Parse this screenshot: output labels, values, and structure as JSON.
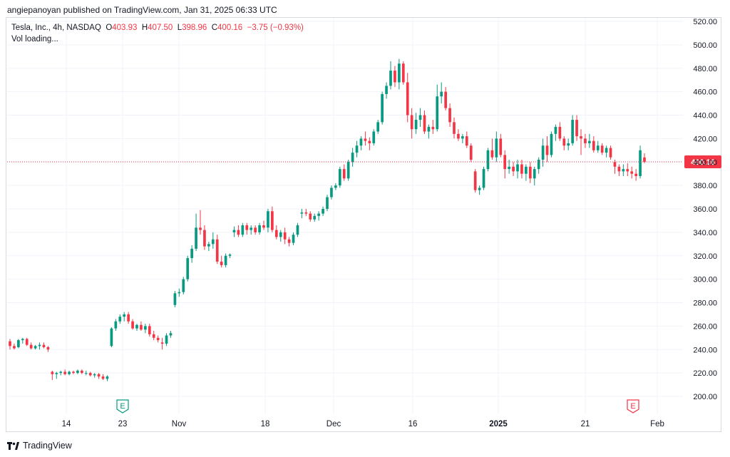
{
  "publisher_line": "angiepanoyan published on TradingView.com, Jan 31, 2025 06:33 UTC",
  "legend": {
    "symbol": "Tesla, Inc., 4h, NASDAQ",
    "o_label": "O",
    "o_value": "403.93",
    "h_label": "H",
    "h_value": "407.50",
    "l_label": "L",
    "l_value": "398.96",
    "c_label": "C",
    "c_value": "400.16",
    "change": "−3.75 (−0.93%)",
    "vol_text": "Vol loading..."
  },
  "footer": {
    "brand": "TradingView"
  },
  "colors": {
    "up": "#089981",
    "down": "#f23645",
    "grid": "#f0f3fa",
    "axis_text": "#131722"
  },
  "chart_data": {
    "type": "candlestick",
    "title": "Tesla, Inc., 4h, NASDAQ",
    "ylim": [
      190,
      525
    ],
    "y_ticks": [
      "520.00",
      "500.00",
      "480.00",
      "460.00",
      "440.00",
      "420.00",
      "400.00",
      "380.00",
      "360.00",
      "340.00",
      "320.00",
      "300.00",
      "280.00",
      "260.00",
      "240.00",
      "220.00",
      "200.00"
    ],
    "x_ticks": [
      "14",
      "23",
      "Nov",
      "18",
      "Dec",
      "16",
      "2025",
      "21",
      "Feb"
    ],
    "last_price_label": "400.16",
    "earnings_markers": [
      {
        "label": "E",
        "after_tick": "23",
        "color": "#089981"
      },
      {
        "label": "E",
        "before_tick": "Feb",
        "color": "#f23645"
      }
    ],
    "candles": [
      [
        247,
        249,
        240,
        243
      ],
      [
        243,
        245,
        240,
        241
      ],
      [
        242,
        249,
        241,
        248
      ],
      [
        248,
        250,
        245,
        249
      ],
      [
        249,
        250,
        243,
        244
      ],
      [
        244,
        246,
        240,
        241
      ],
      [
        241,
        244,
        240,
        243
      ],
      [
        243,
        246,
        240,
        244
      ],
      [
        244,
        246,
        241,
        242
      ],
      [
        242,
        243,
        238,
        240
      ],
      [
        221,
        222,
        214,
        219
      ],
      [
        219,
        221,
        215,
        220
      ],
      [
        220,
        222,
        218,
        221
      ],
      [
        221,
        223,
        218,
        219
      ],
      [
        219,
        222,
        218,
        221
      ],
      [
        221,
        222,
        219,
        220
      ],
      [
        220,
        223,
        219,
        222
      ],
      [
        222,
        223,
        219,
        220
      ],
      [
        220,
        222,
        218,
        220
      ],
      [
        220,
        221,
        217,
        218
      ],
      [
        218,
        220,
        216,
        219
      ],
      [
        219,
        220,
        215,
        217
      ],
      [
        217,
        219,
        214,
        215
      ],
      [
        215,
        218,
        213,
        217
      ],
      [
        243,
        259,
        242,
        258
      ],
      [
        258,
        266,
        256,
        264
      ],
      [
        264,
        270,
        262,
        268
      ],
      [
        268,
        272,
        264,
        270
      ],
      [
        270,
        272,
        262,
        264
      ],
      [
        264,
        266,
        257,
        258
      ],
      [
        258,
        262,
        256,
        261
      ],
      [
        261,
        264,
        256,
        257
      ],
      [
        257,
        262,
        254,
        260
      ],
      [
        260,
        262,
        251,
        253
      ],
      [
        253,
        256,
        248,
        250
      ],
      [
        250,
        252,
        246,
        248
      ],
      [
        246,
        250,
        240,
        245
      ],
      [
        245,
        254,
        243,
        252
      ],
      [
        252,
        256,
        250,
        254
      ],
      [
        278,
        290,
        276,
        288
      ],
      [
        288,
        292,
        285,
        289
      ],
      [
        289,
        302,
        287,
        300
      ],
      [
        300,
        320,
        298,
        318
      ],
      [
        318,
        329,
        314,
        326
      ],
      [
        326,
        356,
        324,
        344
      ],
      [
        344,
        359,
        338,
        342
      ],
      [
        342,
        346,
        325,
        328
      ],
      [
        328,
        332,
        324,
        330
      ],
      [
        330,
        340,
        326,
        334
      ],
      [
        334,
        338,
        313,
        315
      ],
      [
        315,
        320,
        310,
        312
      ],
      [
        312,
        322,
        310,
        320
      ],
      [
        320,
        322,
        318,
        321
      ],
      [
        340,
        345,
        336,
        342
      ],
      [
        342,
        346,
        336,
        338
      ],
      [
        338,
        348,
        336,
        346
      ],
      [
        346,
        348,
        338,
        342
      ],
      [
        342,
        346,
        338,
        344
      ],
      [
        344,
        346,
        338,
        340
      ],
      [
        340,
        348,
        338,
        346
      ],
      [
        346,
        350,
        342,
        344
      ],
      [
        344,
        360,
        340,
        358
      ],
      [
        358,
        362,
        340,
        342
      ],
      [
        342,
        346,
        334,
        336
      ],
      [
        336,
        342,
        332,
        340
      ],
      [
        340,
        344,
        330,
        334
      ],
      [
        334,
        336,
        328,
        331
      ],
      [
        331,
        340,
        329,
        338
      ],
      [
        338,
        348,
        336,
        346
      ],
      [
        356,
        360,
        352,
        357
      ],
      [
        357,
        360,
        354,
        356
      ],
      [
        356,
        358,
        349,
        351
      ],
      [
        351,
        356,
        349,
        354
      ],
      [
        354,
        358,
        350,
        356
      ],
      [
        356,
        362,
        354,
        360
      ],
      [
        360,
        372,
        358,
        370
      ],
      [
        370,
        380,
        368,
        378
      ],
      [
        378,
        382,
        376,
        380
      ],
      [
        380,
        396,
        378,
        394
      ],
      [
        394,
        398,
        384,
        386
      ],
      [
        386,
        402,
        384,
        400
      ],
      [
        400,
        412,
        396,
        408
      ],
      [
        408,
        418,
        404,
        414
      ],
      [
        414,
        422,
        410,
        420
      ],
      [
        420,
        426,
        414,
        418
      ],
      [
        418,
        421,
        410,
        416
      ],
      [
        416,
        428,
        414,
        426
      ],
      [
        426,
        436,
        424,
        434
      ],
      [
        434,
        460,
        432,
        458
      ],
      [
        458,
        468,
        454,
        465
      ],
      [
        465,
        486,
        462,
        478
      ],
      [
        478,
        482,
        464,
        468
      ],
      [
        468,
        488,
        462,
        484
      ],
      [
        484,
        486,
        466,
        468
      ],
      [
        468,
        476,
        434,
        440
      ],
      [
        440,
        446,
        420,
        428
      ],
      [
        428,
        442,
        424,
        436
      ],
      [
        436,
        446,
        430,
        440
      ],
      [
        440,
        444,
        424,
        426
      ],
      [
        426,
        432,
        420,
        430
      ],
      [
        430,
        436,
        424,
        428
      ],
      [
        428,
        466,
        426,
        456
      ],
      [
        456,
        468,
        450,
        460
      ],
      [
        460,
        464,
        444,
        446
      ],
      [
        446,
        450,
        430,
        434
      ],
      [
        434,
        438,
        420,
        424
      ],
      [
        424,
        428,
        418,
        420
      ],
      [
        420,
        424,
        416,
        422
      ],
      [
        422,
        426,
        412,
        414
      ],
      [
        414,
        416,
        400,
        402
      ],
      [
        392,
        394,
        374,
        376
      ],
      [
        376,
        380,
        372,
        378
      ],
      [
        378,
        396,
        376,
        394
      ],
      [
        394,
        412,
        392,
        410
      ],
      [
        410,
        420,
        402,
        404
      ],
      [
        404,
        426,
        400,
        420
      ],
      [
        420,
        424,
        404,
        406
      ],
      [
        406,
        410,
        386,
        394
      ],
      [
        394,
        402,
        390,
        396
      ],
      [
        396,
        400,
        388,
        392
      ],
      [
        392,
        402,
        386,
        398
      ],
      [
        398,
        402,
        386,
        390
      ],
      [
        390,
        398,
        384,
        396
      ],
      [
        396,
        400,
        382,
        386
      ],
      [
        386,
        396,
        380,
        394
      ],
      [
        394,
        404,
        390,
        402
      ],
      [
        402,
        420,
        396,
        414
      ],
      [
        414,
        422,
        400,
        406
      ],
      [
        406,
        426,
        404,
        424
      ],
      [
        424,
        432,
        418,
        430
      ],
      [
        430,
        434,
        418,
        420
      ],
      [
        420,
        422,
        410,
        414
      ],
      [
        414,
        420,
        410,
        416
      ],
      [
        416,
        440,
        414,
        436
      ],
      [
        436,
        440,
        418,
        422
      ],
      [
        422,
        428,
        406,
        420
      ],
      [
        420,
        424,
        412,
        416
      ],
      [
        416,
        424,
        412,
        418
      ],
      [
        418,
        422,
        408,
        410
      ],
      [
        410,
        418,
        408,
        414
      ],
      [
        414,
        416,
        406,
        408
      ],
      [
        408,
        414,
        404,
        412
      ],
      [
        412,
        414,
        402,
        404
      ],
      [
        400,
        402,
        390,
        396
      ],
      [
        396,
        398,
        388,
        392
      ],
      [
        392,
        398,
        388,
        394
      ],
      [
        394,
        399,
        388,
        392
      ],
      [
        392,
        396,
        386,
        390
      ],
      [
        390,
        394,
        384,
        388
      ],
      [
        388,
        414,
        386,
        410
      ],
      [
        403.93,
        407.5,
        398.96,
        400.16
      ]
    ]
  }
}
